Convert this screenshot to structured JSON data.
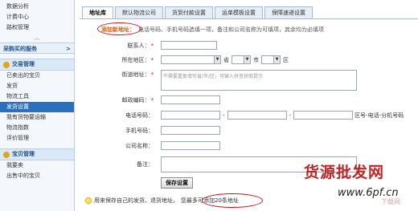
{
  "sidebar": {
    "top_items": [
      "数据分析",
      "计费中心",
      "路权管理"
    ],
    "collapse_arrow": "︿",
    "buy_service": {
      "label": "采购买的服务",
      "arrow": ">"
    },
    "trade_section": {
      "title": "交易管理",
      "items": [
        "已卖出的宝贝",
        "发货",
        "物流工具",
        "发货设置",
        "我有货物要运输",
        "物流指数",
        "评价管理"
      ],
      "active_index": 3
    },
    "goods_section": {
      "title": "宝贝管理",
      "items": [
        "我要卖",
        "出售中的宝贝"
      ]
    }
  },
  "tabs": [
    "地址库",
    "默认物流公司",
    "货到付款设置",
    "运单模板设置",
    "保障速递设置"
  ],
  "active_tab": 0,
  "notice": {
    "title": "添加新地址：",
    "text": "电话号码、手机号码选填一项，备注和公司名称为可填项，其余均为必填项"
  },
  "form": {
    "contact": {
      "label": "联系人：",
      "required": "*"
    },
    "region": {
      "label": "所在地区：",
      "required": "*",
      "province": "省",
      "city": "市",
      "district": "区"
    },
    "street": {
      "label": "街道地址：",
      "required": "*",
      "placeholder": "不需要重复填写省/市/区，可输入拼音获取提示"
    },
    "postcode": {
      "label": "邮政编码：",
      "required": "*"
    },
    "phone": {
      "label": "电话号码：",
      "sep1": "-",
      "sep2": "-",
      "hint": "区号-电话-分机号码"
    },
    "mobile": {
      "label": "手机号码："
    },
    "company": {
      "label": "公司名称："
    },
    "remark": {
      "label": "备注："
    },
    "save_label": "保存设置"
  },
  "tip": {
    "text": "用来保存自己的发货、退货地址，",
    "highlight": "您最多可添加20条地址"
  },
  "watermark": {
    "cn": "货源批发网",
    "url": "www.6pf.cn",
    "small": "下载网"
  }
}
